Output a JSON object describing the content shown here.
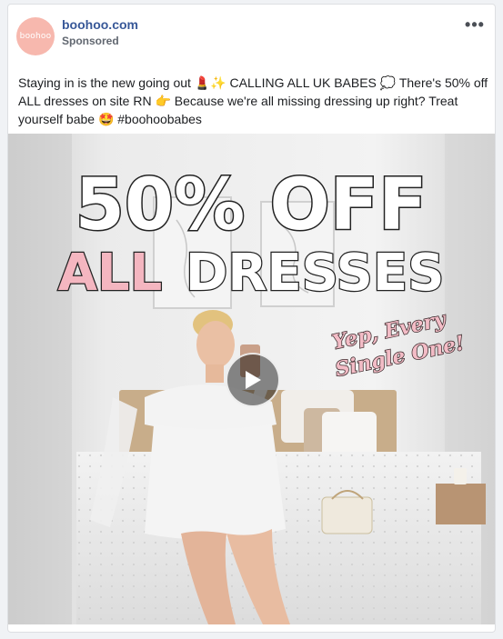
{
  "post": {
    "avatar_text": "boohoo",
    "page_name": "boohoo.com",
    "sponsored_label": "Sponsored",
    "more_label": "•••",
    "caption": "Staying in is the new going out 💄✨ CALLING ALL UK BABES 💭 There's 50% off ALL dresses on site RN 👉 Because we're all missing dressing up right? Treat yourself babe 🤩 #boohoobabes"
  },
  "media": {
    "headline_line1": "50% OFF",
    "headline_line2_accent": "ALL",
    "headline_line2_rest": "DRESSES",
    "script_line1": "Yep, Every",
    "script_line2": "Single One!",
    "play_icon": "play-icon"
  },
  "colors": {
    "brand_link": "#385898",
    "avatar_bg": "#f7b8ae",
    "accent_pink": "#f4b6c0"
  }
}
